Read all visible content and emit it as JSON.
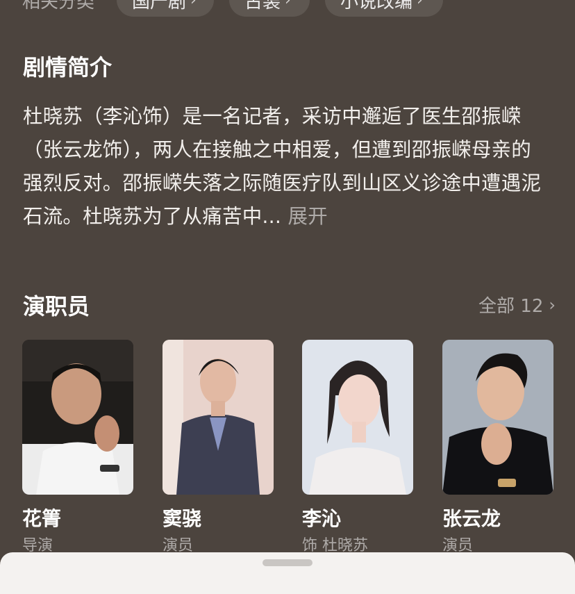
{
  "related": {
    "label": "相关分类",
    "chips": [
      "国产剧",
      "古装",
      "小说改编"
    ]
  },
  "synopsis": {
    "title": "剧情简介",
    "text": "杜晓苏（李沁饰）是一名记者，采访中邂逅了医生邵振嵘（张云龙饰），两人在接触之中相爱，但遭到邵振嵘母亲的强烈反对。邵振嵘失落之际随医疗队到山区义诊途中遭遇泥石流。杜晓苏为了从痛苦中...",
    "expand_label": "展开"
  },
  "cast": {
    "title": "演职员",
    "more_label": "全部 12",
    "members": [
      {
        "name": "花箐",
        "role": "导演"
      },
      {
        "name": "窦骁",
        "role": "演员"
      },
      {
        "name": "李沁",
        "role": "饰 杜晓苏"
      },
      {
        "name": "张云龙",
        "role": "演员"
      }
    ]
  },
  "icons": {
    "chevron": "chevron-right-icon",
    "sheet_handle": "drag-handle"
  },
  "colors": {
    "background": "#4c443e",
    "sheet": "#f4f2f0"
  }
}
